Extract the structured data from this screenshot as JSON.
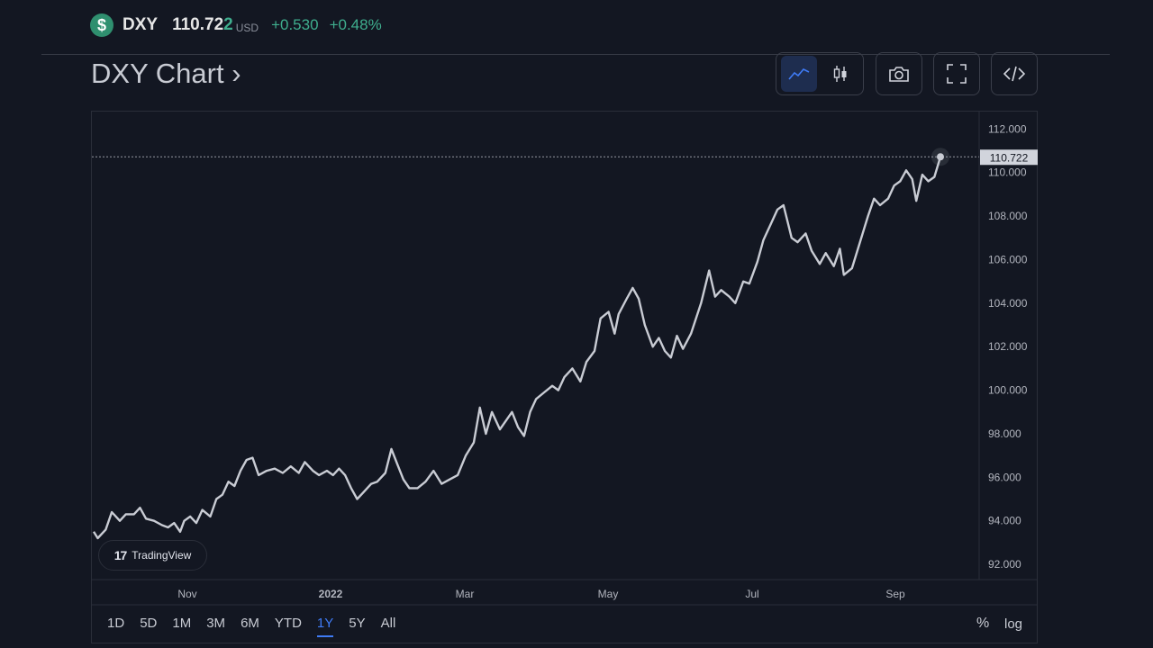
{
  "header": {
    "coin_symbol": "$",
    "ticker": "DXY",
    "price_main": "110.72",
    "price_last_digit": "2",
    "currency": "USD",
    "change_abs": "+0.530",
    "change_pct": "+0.48%"
  },
  "page_title": "DXY Chart ›",
  "toolbar": {
    "line_icon": "line-chart-icon",
    "candle_icon": "candlestick-icon",
    "camera_icon": "camera-icon",
    "fullscreen_icon": "fullscreen-icon",
    "embed_icon": "code-embed-icon"
  },
  "badge": {
    "logo": "17",
    "label": "TradingView"
  },
  "ranges": [
    "1D",
    "5D",
    "1M",
    "3M",
    "6M",
    "YTD",
    "1Y",
    "5Y",
    "All"
  ],
  "active_range": "1Y",
  "scale_toggles": {
    "percent": "%",
    "log": "log"
  },
  "colors": {
    "background": "#131722",
    "line": "#c9ccd4",
    "accent": "#3f7bf5",
    "positive": "#3fae8e"
  },
  "chart_data": {
    "type": "line",
    "ylim": [
      91.3,
      112.8
    ],
    "yticks": [
      "112.000",
      "110.000",
      "108.000",
      "106.000",
      "104.000",
      "102.000",
      "100.000",
      "98.000",
      "96.000",
      "94.000",
      "92.000"
    ],
    "xticks": [
      "Nov",
      "2022",
      "Mar",
      "May",
      "Jul",
      "Sep"
    ],
    "last_price_label": "110.722",
    "last_value": 110.722,
    "points": [
      [
        "2021-10-06",
        93.5
      ],
      [
        "2021-10-08",
        93.2
      ],
      [
        "2021-10-12",
        93.6
      ],
      [
        "2021-10-15",
        94.4
      ],
      [
        "2021-10-19",
        94.0
      ],
      [
        "2021-10-22",
        94.3
      ],
      [
        "2021-10-26",
        94.3
      ],
      [
        "2021-10-29",
        94.6
      ],
      [
        "2021-11-01",
        94.1
      ],
      [
        "2021-11-05",
        94.0
      ],
      [
        "2021-11-09",
        93.8
      ],
      [
        "2021-11-12",
        93.7
      ],
      [
        "2021-11-15",
        93.9
      ],
      [
        "2021-11-18",
        93.5
      ],
      [
        "2021-11-20",
        94.0
      ],
      [
        "2021-11-23",
        94.2
      ],
      [
        "2021-11-26",
        93.9
      ],
      [
        "2021-11-29",
        94.5
      ],
      [
        "2021-12-03",
        94.2
      ],
      [
        "2021-12-06",
        95.0
      ],
      [
        "2021-12-09",
        95.2
      ],
      [
        "2021-12-12",
        95.8
      ],
      [
        "2021-12-15",
        95.6
      ],
      [
        "2021-12-18",
        96.3
      ],
      [
        "2021-12-21",
        96.8
      ],
      [
        "2021-12-24",
        96.9
      ],
      [
        "2021-12-27",
        96.1
      ],
      [
        "2021-12-31",
        96.3
      ],
      [
        "2022-01-04",
        96.4
      ],
      [
        "2022-01-08",
        96.2
      ],
      [
        "2022-01-12",
        96.5
      ],
      [
        "2022-01-16",
        96.2
      ],
      [
        "2022-01-19",
        96.7
      ],
      [
        "2022-01-23",
        96.3
      ],
      [
        "2022-01-26",
        96.1
      ],
      [
        "2022-01-30",
        96.3
      ],
      [
        "2022-02-02",
        96.1
      ],
      [
        "2022-02-05",
        96.4
      ],
      [
        "2022-02-08",
        96.1
      ],
      [
        "2022-02-11",
        95.5
      ],
      [
        "2022-02-14",
        95.0
      ],
      [
        "2022-02-17",
        95.3
      ],
      [
        "2022-02-21",
        95.7
      ],
      [
        "2022-02-24",
        95.8
      ],
      [
        "2022-02-28",
        96.2
      ],
      [
        "2022-03-03",
        97.3
      ],
      [
        "2022-03-06",
        96.6
      ],
      [
        "2022-03-09",
        95.9
      ],
      [
        "2022-03-12",
        95.5
      ],
      [
        "2022-03-16",
        95.5
      ],
      [
        "2022-03-20",
        95.8
      ],
      [
        "2022-03-24",
        96.3
      ],
      [
        "2022-03-28",
        95.7
      ],
      [
        "2022-04-01",
        95.9
      ],
      [
        "2022-04-05",
        96.1
      ],
      [
        "2022-04-09",
        97.0
      ],
      [
        "2022-04-13",
        97.6
      ],
      [
        "2022-04-16",
        99.2
      ],
      [
        "2022-04-19",
        98.0
      ],
      [
        "2022-04-22",
        99.0
      ],
      [
        "2022-04-26",
        98.2
      ],
      [
        "2022-04-29",
        98.6
      ],
      [
        "2022-05-02",
        99.0
      ],
      [
        "2022-05-05",
        98.3
      ],
      [
        "2022-05-08",
        97.9
      ],
      [
        "2022-05-11",
        99.0
      ],
      [
        "2022-05-14",
        99.6
      ],
      [
        "2022-05-18",
        99.9
      ],
      [
        "2022-05-22",
        100.2
      ],
      [
        "2022-05-25",
        100.0
      ],
      [
        "2022-05-28",
        100.6
      ],
      [
        "2022-06-01",
        101.0
      ],
      [
        "2022-06-05",
        100.4
      ],
      [
        "2022-06-08",
        101.3
      ],
      [
        "2022-06-12",
        101.8
      ],
      [
        "2022-06-15",
        103.3
      ],
      [
        "2022-06-19",
        103.6
      ],
      [
        "2022-06-22",
        102.6
      ],
      [
        "2022-06-24",
        103.5
      ],
      [
        "2022-06-28",
        104.2
      ],
      [
        "2022-07-01",
        104.7
      ],
      [
        "2022-07-04",
        104.2
      ],
      [
        "2022-07-07",
        103.0
      ],
      [
        "2022-07-11",
        102.0
      ],
      [
        "2022-07-14",
        102.4
      ],
      [
        "2022-07-17",
        101.8
      ],
      [
        "2022-07-20",
        101.5
      ],
      [
        "2022-07-23",
        102.5
      ],
      [
        "2022-07-26",
        101.9
      ],
      [
        "2022-07-30",
        102.6
      ],
      [
        "2022-08-04",
        104.0
      ],
      [
        "2022-08-08",
        105.5
      ],
      [
        "2022-08-11",
        104.3
      ],
      [
        "2022-08-14",
        104.6
      ],
      [
        "2022-08-18",
        104.3
      ],
      [
        "2022-08-21",
        104.0
      ],
      [
        "2022-08-25",
        105.0
      ],
      [
        "2022-08-28",
        104.9
      ],
      [
        "2022-09-01",
        105.9
      ],
      [
        "2022-09-04",
        106.9
      ],
      [
        "2022-09-07",
        107.5
      ],
      [
        "2022-09-11",
        108.3
      ],
      [
        "2022-09-14",
        108.5
      ],
      [
        "2022-09-18",
        107.0
      ],
      [
        "2022-09-21",
        106.8
      ],
      [
        "2022-09-25",
        107.2
      ],
      [
        "2022-09-28",
        106.4
      ],
      [
        "2022-10-02",
        105.8
      ],
      [
        "2022-10-05",
        106.3
      ],
      [
        "2022-10-09",
        105.7
      ],
      [
        "2022-10-12",
        106.5
      ],
      [
        "2022-10-14",
        105.3
      ],
      [
        "2022-10-18",
        105.6
      ],
      [
        "2022-10-22",
        106.8
      ],
      [
        "2022-10-26",
        108.0
      ],
      [
        "2022-10-29",
        108.8
      ],
      [
        "2022-11-01",
        108.5
      ],
      [
        "2022-11-05",
        108.8
      ],
      [
        "2022-11-08",
        109.4
      ],
      [
        "2022-11-11",
        109.6
      ],
      [
        "2022-11-14",
        110.1
      ],
      [
        "2022-11-17",
        109.7
      ],
      [
        "2022-11-19",
        108.7
      ],
      [
        "2022-11-22",
        109.9
      ],
      [
        "2022-11-25",
        109.6
      ],
      [
        "2022-11-28",
        109.8
      ],
      [
        "2022-12-01",
        110.722
      ]
    ]
  }
}
